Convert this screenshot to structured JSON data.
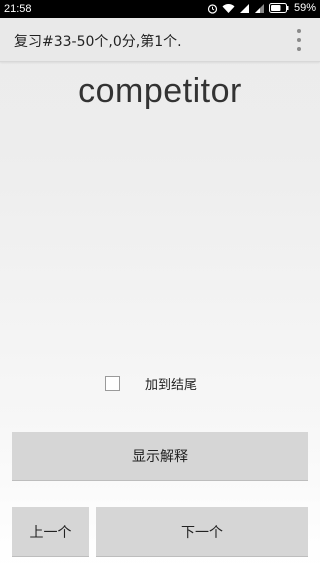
{
  "status_bar": {
    "time": "21:58",
    "battery_percent": "59%",
    "icons": [
      "alarm-icon",
      "wifi-icon",
      "signal-icon",
      "signal-icon",
      "battery-icon"
    ]
  },
  "action_bar": {
    "title": "复习#33-50个,0分,第1个."
  },
  "card": {
    "word": "competitor"
  },
  "checkbox": {
    "label": "加到结尾",
    "checked": false
  },
  "buttons": {
    "show_explanation": "显示解释",
    "previous": "上一个",
    "next": "下一个"
  },
  "colors": {
    "status_bar_bg": "#000000",
    "action_bar_bg": "#e9e9e9",
    "button_bg": "#d6d6d6"
  }
}
